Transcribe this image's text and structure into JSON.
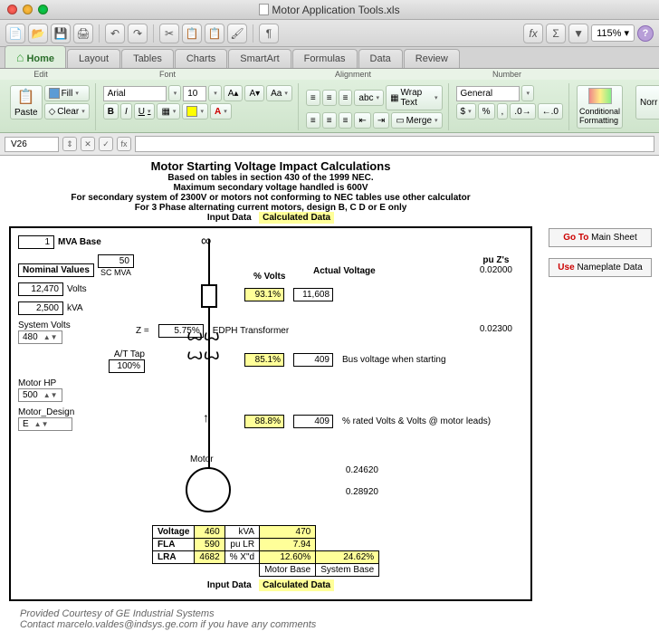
{
  "window": {
    "title": "Motor Application Tools.xls"
  },
  "toolbar": {
    "zoom": "115%"
  },
  "tabs": [
    "Home",
    "Layout",
    "Tables",
    "Charts",
    "SmartArt",
    "Formulas",
    "Data",
    "Review"
  ],
  "ribbon": {
    "groups": [
      "Edit",
      "Font",
      "Alignment",
      "Number"
    ],
    "paste": "Paste",
    "fill": "Fill",
    "clear": "Clear",
    "font_name": "Arial",
    "font_size": "10",
    "wrap": "Wrap Text",
    "merge": "Merge",
    "number_format": "General",
    "cond": "Conditional Formatting",
    "norm": "Norr"
  },
  "formula_bar": {
    "cell": "V26",
    "fx": "fx"
  },
  "title_block": {
    "title": "Motor Starting Voltage Impact Calculations",
    "sub1": "Based on tables in section 430 of the 1999 NEC.",
    "sub2": "Maximum secondary voltage handled is 600V",
    "sub3": "For secondary system of 2300V or motors not conforming to NEC tables use other calculator",
    "sub4": "For 3 Phase alternating current motors, design B, C D or E only",
    "legend_input": "Input Data",
    "legend_calc": "Calculated Data"
  },
  "side": {
    "goto_r": "Go To",
    "goto": "Main Sheet",
    "use_r": "Use",
    "use": "Nameplate Data"
  },
  "inputs": {
    "mva_base": "1",
    "mva_base_lbl": "MVA Base",
    "nominal_lbl": "Nominal Values",
    "scmva": "50",
    "scmva_lbl": "SC MVA",
    "volts": "12,470",
    "volts_lbl": "Volts",
    "kva": "2,500",
    "kva_lbl": "kVA",
    "sysv_lbl": "System Volts",
    "sysv": "480",
    "tap_lbl": "A/T Tap",
    "tap": "100%",
    "hp_lbl": "Motor HP",
    "hp": "500",
    "design_lbl": "Motor_Design",
    "design": "E"
  },
  "calc": {
    "z_lbl": "Z  =",
    "z": "5.75%",
    "pct_volts_h": "% Volts",
    "act_v_h": "Actual Voltage",
    "puz_h": "pu Z's",
    "r1_pct": "93.1%",
    "r1_v": "11,608",
    "r1_pu": "0.02000",
    "edph": "EDPH Transformer",
    "r2_pu": "0.02300",
    "r3_pct": "85.1%",
    "r3_v": "409",
    "r3_txt": "Bus voltage when starting",
    "r4_pct": "88.8%",
    "r4_v": "409",
    "r4_txt": "% rated Volts & Volts @ motor leads)",
    "r5_pu": "0.24620",
    "r6_pu": "0.28920",
    "motor_lbl": "Motor"
  },
  "mtable": {
    "r1": [
      "Voltage",
      "460",
      "kVA",
      "470"
    ],
    "r2": [
      "FLA",
      "590",
      "pu LR",
      "7.94"
    ],
    "r3": [
      "LRA",
      "4682",
      "% X\"d",
      "12.60%",
      "24.62%"
    ],
    "r4": [
      "",
      "",
      "",
      "Motor Base",
      "System Base"
    ]
  },
  "credits": {
    "l1": "Provided Courtesy of GE Industrial Systems",
    "l2": "Contact marcelo.valdes@indsys.ge.com if you have any comments"
  }
}
